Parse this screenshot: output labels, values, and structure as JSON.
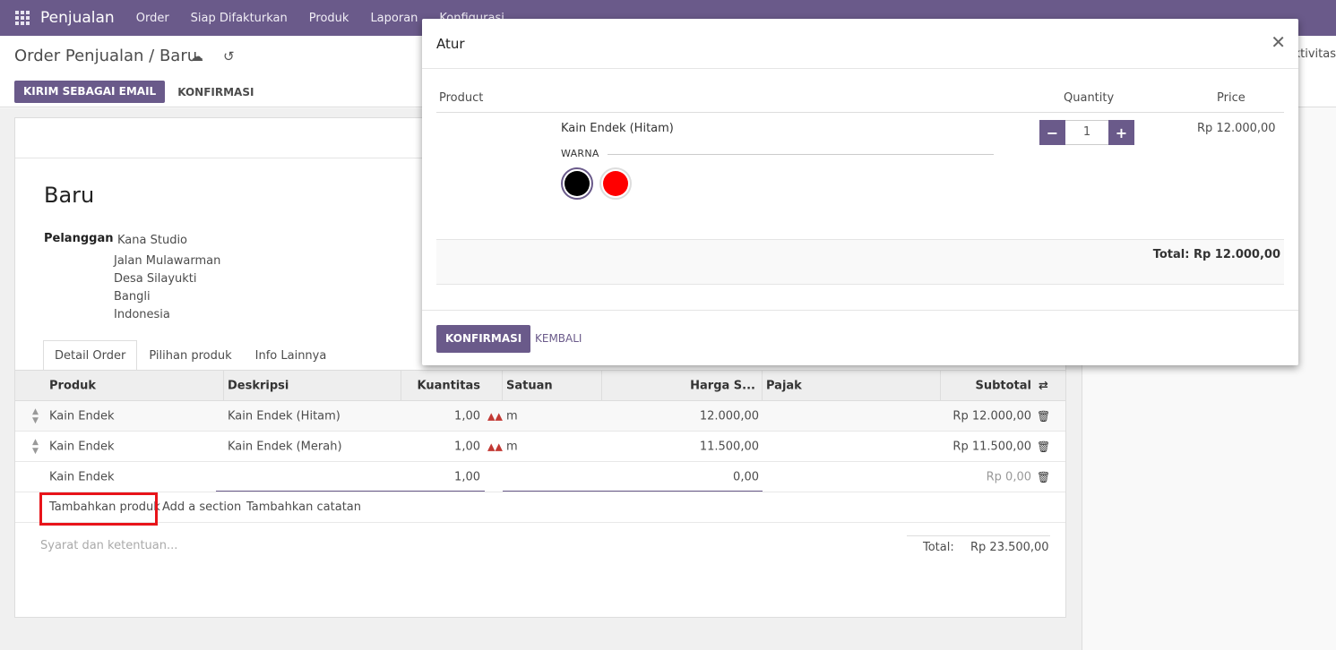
{
  "navbar": {
    "brand": "Penjualan",
    "menu": [
      "Order",
      "Siap Difakturkan",
      "Produk",
      "Laporan",
      "Konfigurasi"
    ]
  },
  "control_panel": {
    "breadcrumb": "Order Penjualan / Baru",
    "icons": [
      "cloud-upload-icon",
      "undo-icon"
    ],
    "send_email": "KIRIM SEBAGAI EMAIL",
    "confirm": "KONFIRMASI",
    "aktivitas": "Aktivitas"
  },
  "form": {
    "title": "Baru",
    "customer_label": "Pelanggan",
    "customer_name": "Kana Studio",
    "address": [
      "Jalan Mulawarman",
      "Desa Silayukti",
      "Bangli",
      "Indonesia"
    ],
    "tabs": [
      "Detail Order",
      "Pilihan produk",
      "Info Lainnya"
    ],
    "columns": [
      "Produk",
      "Deskripsi",
      "Kuantitas",
      "Satuan",
      "Harga S...",
      "Pajak",
      "Subtotal"
    ],
    "lines": [
      {
        "product": "Kain Endek",
        "description": "Kain Endek (Hitam)",
        "qty": "1,00",
        "uom": "m",
        "price": "12.000,00",
        "subtotal": "Rp 12.000,00"
      },
      {
        "product": "Kain Endek",
        "description": "Kain Endek (Merah)",
        "qty": "1,00",
        "uom": "m",
        "price": "11.500,00",
        "subtotal": "Rp 11.500,00"
      },
      {
        "product": "Kain Endek",
        "description": "",
        "qty": "1,00",
        "uom": "",
        "price": "0,00",
        "subtotal": "Rp 0,00"
      }
    ],
    "add_product": "Tambahkan produk",
    "add_section": "Add a section",
    "add_note": "Tambahkan catatan",
    "terms_placeholder": "Syarat dan ketentuan...",
    "total_label": "Total:",
    "total_value": "Rp 23.500,00"
  },
  "modal": {
    "title": "Atur",
    "col_product": "Product",
    "col_quantity": "Quantity",
    "col_price": "Price",
    "product_name": "Kain Endek (Hitam)",
    "attribute_label": "WARNA",
    "colors": [
      "#000000",
      "#ff0000"
    ],
    "quantity": "1",
    "price": "Rp 12.000,00",
    "total": "Total: Rp 12.000,00",
    "confirm": "KONFIRMASI",
    "back": "KEMBALI"
  },
  "colors": {
    "brand": "#6a5a8a",
    "highlight": "#e8141a"
  }
}
